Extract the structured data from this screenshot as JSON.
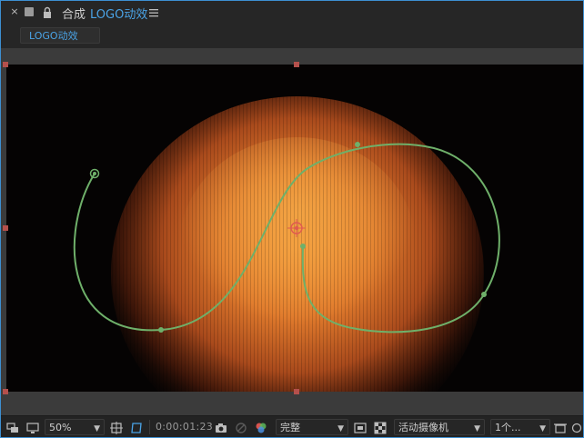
{
  "panel": {
    "tab_prefix": "合成",
    "tab_name": "LOGO动效",
    "comp_chip": "LOGO动效"
  },
  "toolbar": {
    "zoom": "50%",
    "timecode": "0:00:01:23",
    "resolution": "完整",
    "camera": "活动摄像机",
    "views": "1个..."
  },
  "colors": {
    "accent_blue": "#4aa3e6",
    "motion_path": "#6fb06a",
    "particle_core": "#e07a2c"
  }
}
